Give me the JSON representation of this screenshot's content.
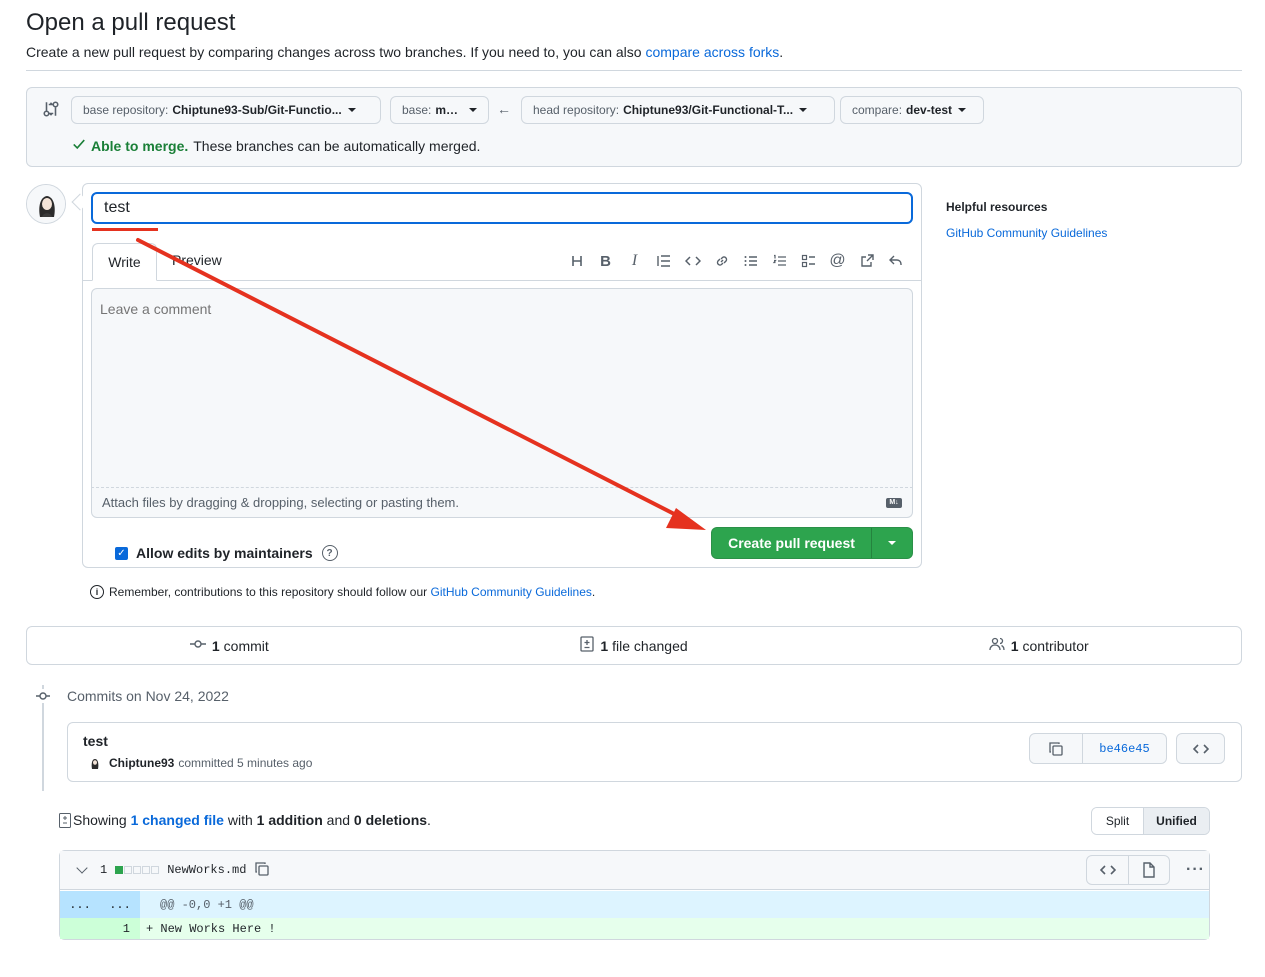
{
  "header": {
    "title": "Open a pull request",
    "description": "Create a new pull request by comparing changes across two branches. If you need to, you can also",
    "compare_link": "compare across forks",
    "description_end": "."
  },
  "range": {
    "base_repo_label": "base repository:",
    "base_repo_value": "Chiptune93-Sub/Git-Functio...",
    "base_label": "base:",
    "base_value": "main",
    "head_repo_label": "head repository:",
    "head_repo_value": "Chiptune93/Git-Functional-T...",
    "compare_label": "compare:",
    "compare_value": "dev-test",
    "merge_ok": "Able to merge.",
    "merge_text": "These branches can be automatically merged."
  },
  "form": {
    "title_value": "test",
    "tab_write": "Write",
    "tab_preview": "Preview",
    "toolbar_icons": [
      "heading-icon",
      "bold-icon",
      "italic-icon",
      "quote-icon",
      "code-icon",
      "link-icon",
      "unordered-list-icon",
      "ordered-list-icon",
      "task-list-icon",
      "mention-icon",
      "reference-icon",
      "reply-icon"
    ],
    "comment_placeholder": "Leave a comment",
    "attach_text": "Attach files by dragging & dropping, selecting or pasting them.",
    "allow_edits": "Allow edits by maintainers",
    "create_button": "Create pull request",
    "remember_text": "Remember, contributions to this repository should follow our",
    "remember_link": "GitHub Community Guidelines",
    "remember_end": "."
  },
  "sidebar": {
    "title": "Helpful resources",
    "link": "GitHub Community Guidelines"
  },
  "summary": {
    "commits_count": "1",
    "commits_label": "commit",
    "files_count": "1",
    "files_label": "file changed",
    "contributors_count": "1",
    "contributors_label": "contributor"
  },
  "commits": {
    "date_heading": "Commits on Nov 24, 2022",
    "items": [
      {
        "title": "test",
        "author": "Chiptune93",
        "meta": "committed 5 minutes ago",
        "sha": "be46e45"
      }
    ]
  },
  "diff": {
    "showing": "Showing",
    "changed_link": "1 changed file",
    "with": "with",
    "additions": "1 addition",
    "and": "and",
    "deletions": "0 deletions",
    "end": ".",
    "split": "Split",
    "unified": "Unified",
    "file": {
      "count": "1",
      "name": "NewWorks.md",
      "diffstat": [
        1,
        0,
        0,
        0,
        0
      ],
      "hunk_left": "...",
      "hunk_right": "...",
      "hunk_header": "@@ -0,0 +1 @@",
      "line_number": "1",
      "line_content": "+ New Works Here !"
    }
  },
  "colors": {
    "accent": "#0969da",
    "success": "#1a7f37",
    "button_green": "#2da44e",
    "annotation_red": "#e5321f"
  }
}
